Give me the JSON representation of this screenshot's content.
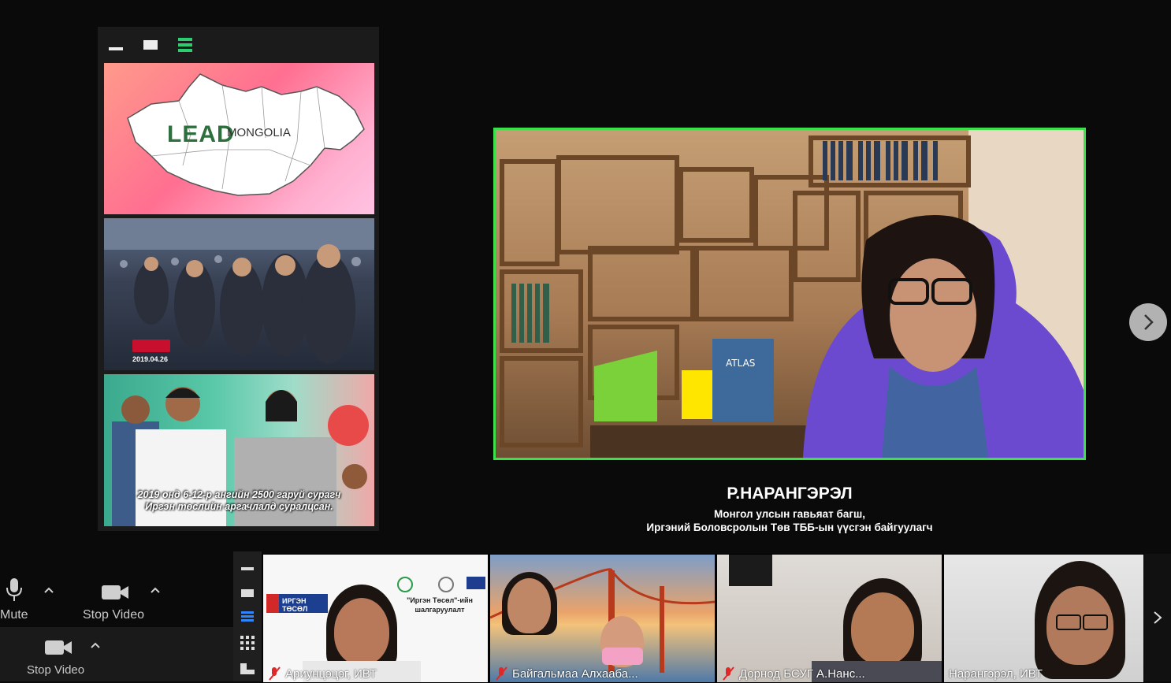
{
  "left_panel": {
    "slides": [
      {
        "lead_word": "LEAD",
        "mongolia_word": "MONGOLIA"
      },
      {
        "date": "2019.04.26"
      },
      {
        "caption_line1": "2019 онд 6-12-р ангийн 2500 гаруй сурагч",
        "caption_line2": "Иргэн төслийн аргачлалд суралцсан."
      }
    ]
  },
  "main_speaker": {
    "name": "Р.НАРАНГЭРЭЛ",
    "title_line1": "Монгол улсын гавьяат багш,",
    "title_line2": "Иргэний Боловсролын Төв ТББ-ын үүсгэн байгуулагч",
    "book_label": "ATLAS"
  },
  "controls": {
    "mute_label": "Mute",
    "stop_video_label": "Stop Video",
    "bottom_stop_video_label": "Stop Video"
  },
  "participants": [
    {
      "name": "Ариунцэцэг, ИВТ",
      "muted": true,
      "slide_text": "\"Иргэн Төсөл\"-ийн шалгаруулалт",
      "logo_text": "ИРГЭН ТӨСӨЛ"
    },
    {
      "name": "Байгальмаа Алхааба...",
      "muted": true
    },
    {
      "name": "Дорнод БСУГ А.Нанс...",
      "muted": true
    },
    {
      "name": "Нарангэрэл, ИВТ",
      "muted": false
    }
  ],
  "colors": {
    "active_speaker_border": "#3de04a",
    "gallery_icon": "#2ecc71",
    "muted_mic": "#e02828",
    "active_strip_icon": "#2e86ff"
  },
  "icons": [
    "microphone-icon",
    "video-camera-icon",
    "chevron-up-icon",
    "chevron-right-icon",
    "grid-icon",
    "muted-mic-icon"
  ]
}
